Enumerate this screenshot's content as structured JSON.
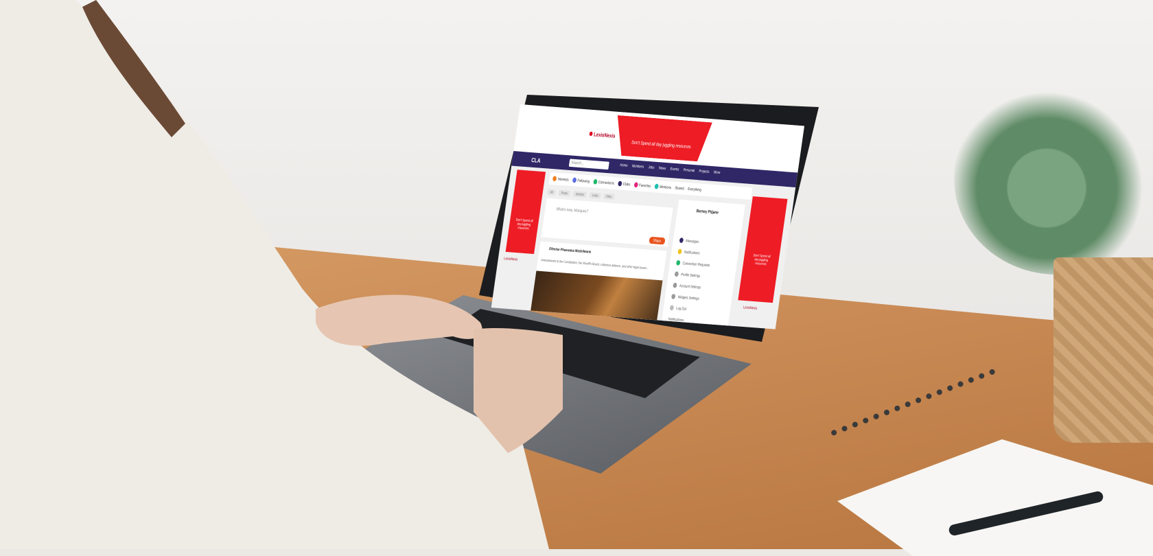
{
  "screen": {
    "brand": "CLA",
    "search_placeholder": "Search...",
    "ad": {
      "logo_text": "LexisNexis",
      "banner_text": "Don't Spend all day juggling resources"
    },
    "nav_items": [
      "Home",
      "Members",
      "Jobs",
      "News",
      "Events",
      "Personal",
      "Projects",
      "More"
    ],
    "filters": [
      "Interests",
      "Following",
      "Connections",
      "Clubs",
      "Favorites",
      "Mentions",
      "Shared"
    ],
    "filter_select": "Everything",
    "subtabs": [
      "All",
      "Posts",
      "Articles",
      "Links",
      "Files"
    ],
    "composer_placeholder": "What's new, Marques?",
    "share_button": "Share",
    "post": {
      "author": "Ofentse Phaswana Mashilwane",
      "text": "Amendments to the Constitution, the Sheriff's Board, collective defence, and other legal issues..."
    },
    "profile": {
      "name": "Barney Pitjane",
      "menu": [
        "Messages",
        "Notifications",
        "Connection Requests",
        "Profile Settings",
        "Account Settings",
        "Widgets Settings",
        "Log Out"
      ]
    },
    "notifications_label": "Notifications"
  },
  "colors": {
    "nav": "#2f2766",
    "ad_red": "#ee1c25",
    "accent_orange": "#e8541e"
  }
}
